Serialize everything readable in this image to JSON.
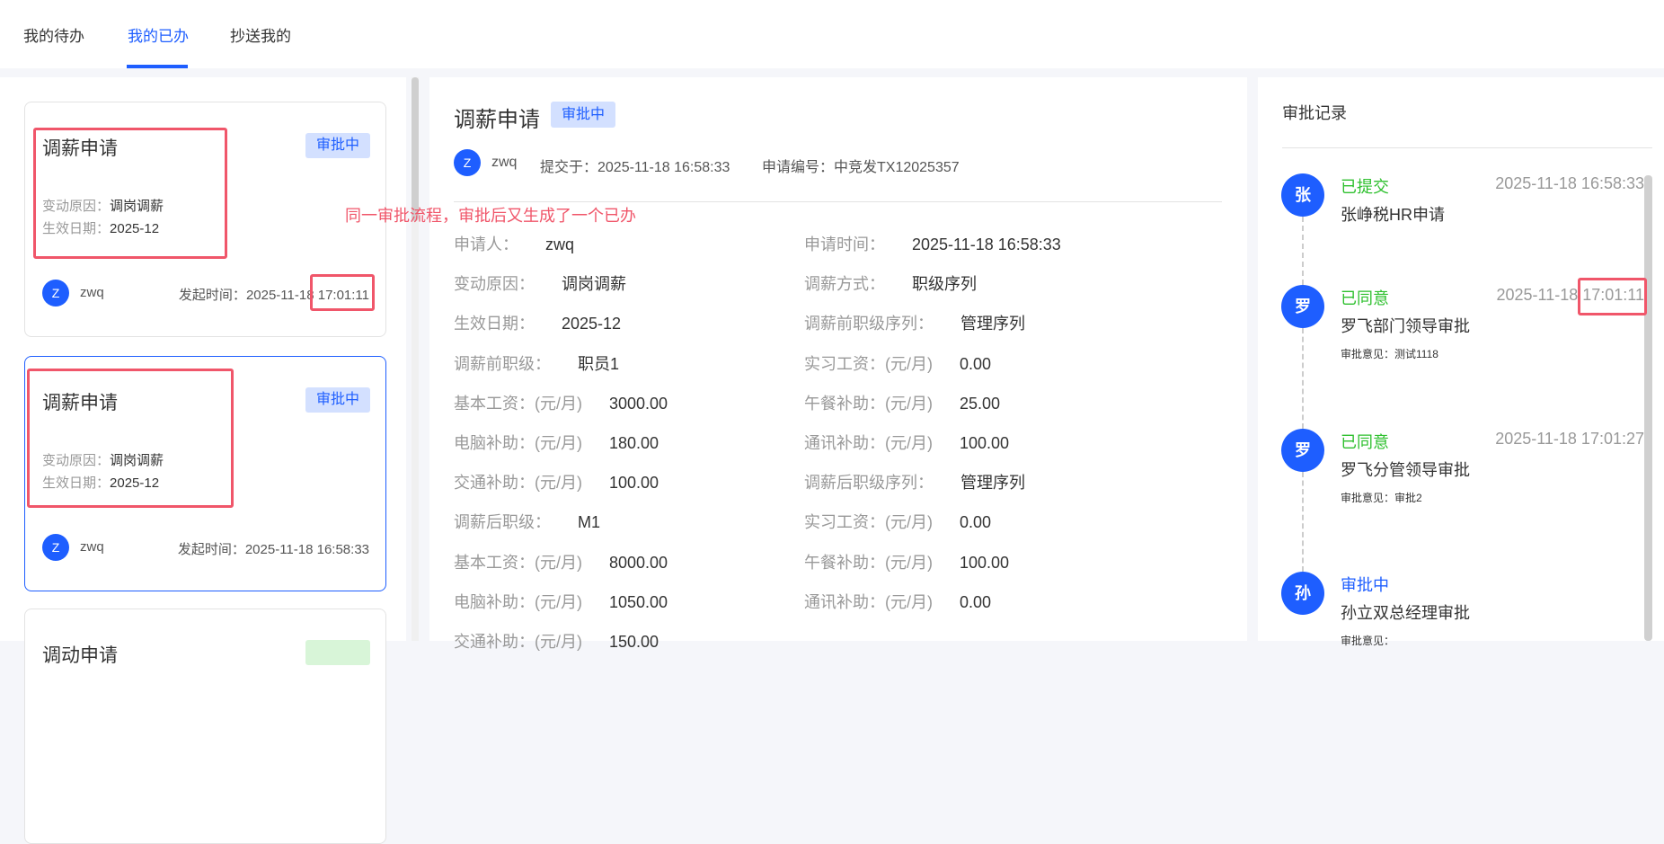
{
  "tabs": [
    {
      "label": "我的待办"
    },
    {
      "label": "我的已办"
    },
    {
      "label": "抄送我的"
    }
  ],
  "active_tab": "我的已办",
  "cards": [
    {
      "title": "调薪申请",
      "status": "审批中",
      "reason_label": "变动原因：",
      "reason": "调岗调薪",
      "date_label": "生效日期：",
      "date": "2025-12",
      "avatar": "Z",
      "user": "zwq",
      "time_label": "发起时间：",
      "time": "2025-11-18 17:01:11"
    },
    {
      "title": "调薪申请",
      "status": "审批中",
      "reason_label": "变动原因：",
      "reason": "调岗调薪",
      "date_label": "生效日期：",
      "date": "2025-12",
      "avatar": "Z",
      "user": "zwq",
      "time_label": "发起时间：",
      "time": "2025-11-18 16:58:33"
    },
    {
      "title": "调动申请",
      "status": ""
    }
  ],
  "annotation": "同一审批流程，审批后又生成了一个已办",
  "detail": {
    "title": "调薪申请",
    "status": "审批中",
    "avatar": "Z",
    "user": "zwq",
    "submitted": "提交于：2025-11-18 16:58:33",
    "number": "申请编号：中竞发TX12025357",
    "left": [
      {
        "label": "申请人：",
        "value": "zwq"
      },
      {
        "label": "变动原因：",
        "value": "调岗调薪"
      },
      {
        "label": "生效日期：",
        "value": "2025-12"
      },
      {
        "label": "调薪前职级：",
        "value": "职员1"
      },
      {
        "label": "基本工资：(元/月)",
        "value": "3000.00"
      },
      {
        "label": "电脑补助：(元/月)",
        "value": "180.00"
      },
      {
        "label": "交通补助：(元/月)",
        "value": "100.00"
      },
      {
        "label": "调薪后职级：",
        "value": "M1"
      },
      {
        "label": "基本工资：(元/月)",
        "value": "8000.00"
      },
      {
        "label": "电脑补助：(元/月)",
        "value": "1050.00"
      },
      {
        "label": "交通补助：(元/月)",
        "value": "150.00"
      }
    ],
    "right": [
      {
        "label": "申请时间：",
        "value": "2025-11-18 16:58:33"
      },
      {
        "label": "调薪方式：",
        "value": "职级序列"
      },
      {
        "label": "调薪前职级序列：",
        "value": "管理序列"
      },
      {
        "label": "实习工资：(元/月)",
        "value": "0.00"
      },
      {
        "label": "午餐补助：(元/月)",
        "value": "25.00"
      },
      {
        "label": "通讯补助：(元/月)",
        "value": "100.00"
      },
      {
        "label": "调薪后职级序列：",
        "value": "管理序列"
      },
      {
        "label": "实习工资：(元/月)",
        "value": "0.00"
      },
      {
        "label": "午餐补助：(元/月)",
        "value": "100.00"
      },
      {
        "label": "通讯补助：(元/月)",
        "value": "0.00"
      }
    ]
  },
  "records": {
    "title": "审批记录",
    "items": [
      {
        "avatar": "张",
        "status": "已提交",
        "status_color": "#2ec02e",
        "time": "2025-11-18 16:58:33",
        "name": "张峥税HR申请",
        "opinion": ""
      },
      {
        "avatar": "罗",
        "status": "已同意",
        "status_color": "#2ec02e",
        "time": "2025-11-18 17:01:11",
        "name": "罗飞部门领导审批",
        "opinion": "审批意见：测试1118"
      },
      {
        "avatar": "罗",
        "status": "已同意",
        "status_color": "#2ec02e",
        "time": "2025-11-18 17:01:27",
        "name": "罗飞分管领导审批",
        "opinion": "审批意见：审批2"
      },
      {
        "avatar": "孙",
        "status": "审批中",
        "status_color": "#1e5eff",
        "time": "",
        "name": "孙立双总经理审批",
        "opinion": "审批意见："
      }
    ]
  }
}
